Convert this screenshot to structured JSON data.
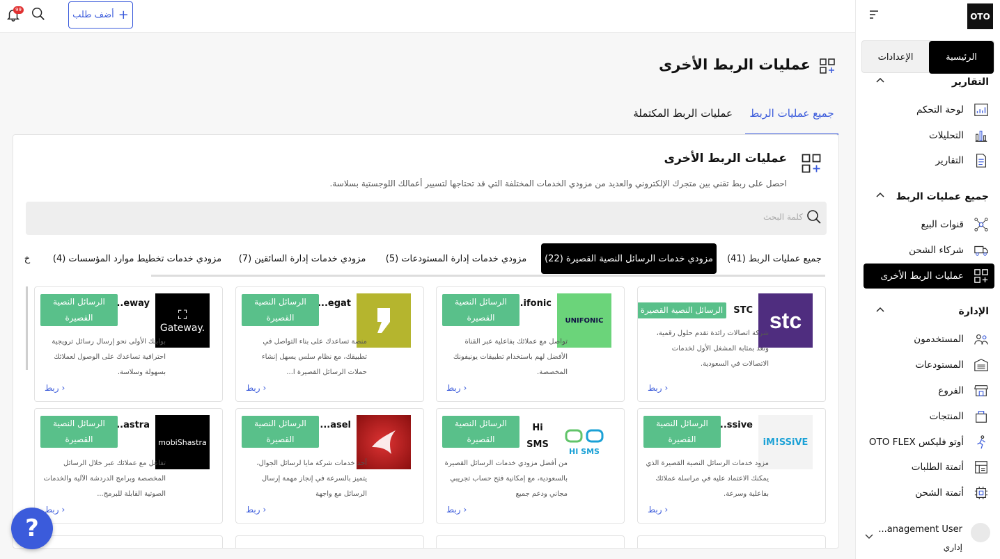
{
  "topbar": {
    "add_order_label": "أضف طلب",
    "notification_count": "99"
  },
  "sidebar": {
    "logo": "OTO",
    "segments": {
      "home": "الرئيسية",
      "settings": "الإعدادات"
    },
    "sections": [
      {
        "title": "التقارير",
        "items": [
          {
            "label": "لوحة التحكم",
            "icon": "dashboard-icon"
          },
          {
            "label": "التحليلات",
            "icon": "analytics-icon"
          },
          {
            "label": "التقارير",
            "icon": "report-icon"
          }
        ]
      },
      {
        "title": "جميع عمليات الربط",
        "items": [
          {
            "label": "قنوات البيع",
            "icon": "sales-channels-icon"
          },
          {
            "label": "شركاء الشحن",
            "icon": "shipping-truck-icon"
          },
          {
            "label": "عمليات الربط الأخرى",
            "icon": "integrations-icon",
            "active": true
          }
        ]
      },
      {
        "title": "الإدارة",
        "items": [
          {
            "label": "المستخدمون",
            "icon": "users-icon"
          },
          {
            "label": "المستودعات",
            "icon": "warehouse-icon"
          },
          {
            "label": "الفروع",
            "icon": "store-icon"
          },
          {
            "label": "المنتجات",
            "icon": "products-icon"
          },
          {
            "label": "أوتو فليكس OTO FLEX",
            "icon": "flex-icon"
          },
          {
            "label": "أتمتة الطلبات",
            "icon": "order-automation-icon"
          },
          {
            "label": "أتمتة الشحن",
            "icon": "shipping-automation-icon"
          }
        ]
      }
    ],
    "user": {
      "name": "...anagement User",
      "role": "إداري"
    }
  },
  "page": {
    "title": "عمليات الربط الأخرى",
    "tabs": {
      "all": "جميع عمليات الربط",
      "completed": "عمليات الربط المكتملة"
    }
  },
  "card": {
    "title": "عمليات الربط الأخرى",
    "description": "احصل على ربط تقني بين متجرك الإلكتروني والعديد من مزودي الخدمات المختلفة التي قد تحتاجها لتسيير أعمالك اللوجستية بسلاسة.",
    "search_placeholder": "كلمة البحث",
    "filters": [
      "جميع عمليات الربط (41)",
      "مزودي خدمات الرسائل النصية القصيرة (22)",
      "مزودي خدمات إدارة المستودعات (5)",
      "مزودي خدمات إدارة السائقين (7)",
      "مزودي خدمات تخطيط موارد المؤسسات (4)",
      "خ"
    ],
    "link_label": "ربط",
    "providers": [
      {
        "name": "STC",
        "tag": "الرسائل النصية القصيرة",
        "desc": "شركة اتصالات رائدة تقدم حلول رقمية، وتعد بمثابة المشغل الأول لخدمات الاتصالات في السعودية.",
        "logo_text": "stc",
        "logo_bg": "#4f2d7f"
      },
      {
        "name": "...ifonic",
        "tag": "الرسائل النصية القصيرة",
        "desc": "تواصل مع عملائك بفاعلية عبر القناة الأفضل لهم باستخدام تطبيقات يونيفونك المخصصة.",
        "logo_text": "UNIFONIC",
        "logo_bg": "#6bd47a"
      },
      {
        "name": "...egat",
        "tag": "الرسائل النصية القصيرة",
        "desc": "منصة تساعدك على بناء التواصل في تطبيقك، مع نظام سلس يسهل إنشاء حملات الرسائل القصيرة ا...",
        "logo_text": "",
        "logo_bg": "#b5b52e"
      },
      {
        "name": "...eway",
        "tag": "الرسائل النصية القصيرة",
        "desc": "بوابتك الأولى نحو إرسال رسائل ترويجية احترافية تساعدك على الوصول لعملائك بسهولة وسلاسة.",
        "logo_text": "Gateway.",
        "logo_bg": "#000000"
      },
      {
        "name": "...ssive",
        "tag": "الرسائل النصية القصيرة",
        "desc": "مزود خدمات الرسائل النصية القصيرة الذي يمكنك الاعتماد عليه في مراسلة عملائك بفاعلية وسرعة.",
        "logo_text": "iM!SSiVE",
        "logo_bg": "#f3f3f3"
      },
      {
        "name": "Hi SMS",
        "tag": "الرسائل النصية القصيرة",
        "desc": "من أفضل مزودي خدمات الرسائل القصيرة بالسعودية، مع إمكانية فتح حساب تجريبي مجاني ودعم جميع",
        "logo_text": "HI SMS",
        "logo_bg": "#ffffff"
      },
      {
        "name": "...asel",
        "tag": "الرسائل النصية القصيرة",
        "desc": "أحد خدمات شركة مايا لرسائل الجوال، يتميز بالسرعة في إنجاز مهمة إرسال الرسائل مع واجهة",
        "logo_text": "",
        "logo_bg": "#b81e1e"
      },
      {
        "name": "...astra",
        "tag": "الرسائل النصية القصيرة",
        "desc": "تفاعل مع عملائك عبر خلال الرسائل المخصصة وبرامج الدردشة الآلية والخدمات الصوتية القابلة للبرمج...",
        "logo_text": "mobiShastra",
        "logo_bg": "#000000"
      }
    ]
  },
  "help": {
    "label": "?"
  }
}
